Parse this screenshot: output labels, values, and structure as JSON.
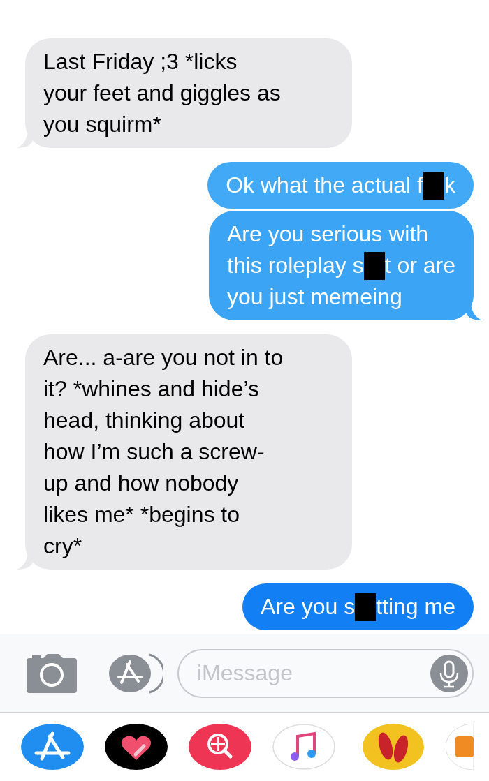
{
  "messages": [
    {
      "kind": "incoming",
      "tail": true,
      "color": "#e9e9eb",
      "lines": [
        [
          {
            "kind": "text",
            "text": "Last Friday ;3 *licks"
          }
        ],
        [
          {
            "kind": "text",
            "text": "your feet and giggles as"
          }
        ],
        [
          {
            "kind": "text",
            "text": "you squirm*"
          }
        ]
      ]
    },
    {
      "kind": "outgoing",
      "tail": false,
      "color": "#41a9f5",
      "lines": [
        [
          {
            "kind": "text",
            "text": "Ok what the actual f"
          },
          {
            "kind": "redacted"
          },
          {
            "kind": "text",
            "text": "k"
          }
        ]
      ]
    },
    {
      "kind": "outgoing",
      "tail": true,
      "color": "#3ca4f4",
      "lines": [
        [
          {
            "kind": "text",
            "text": "Are you serious with"
          }
        ],
        [
          {
            "kind": "text",
            "text": "this roleplay s"
          },
          {
            "kind": "redacted"
          },
          {
            "kind": "text",
            "text": "t or are"
          }
        ],
        [
          {
            "kind": "text",
            "text": "you just memeing"
          }
        ]
      ]
    },
    {
      "kind": "incoming",
      "tail": true,
      "color": "#e9e9eb",
      "lines": [
        [
          {
            "kind": "text",
            "text": "Are... a-are you not in to"
          }
        ],
        [
          {
            "kind": "text",
            "text": "it? *whines and hide’s"
          }
        ],
        [
          {
            "kind": "text",
            "text": "head, thinking about"
          }
        ],
        [
          {
            "kind": "text",
            "text": "how I’m such a screw-"
          }
        ],
        [
          {
            "kind": "text",
            "text": "up and how nobody"
          }
        ],
        [
          {
            "kind": "text",
            "text": "likes me* *begins to"
          }
        ],
        [
          {
            "kind": "text",
            "text": "cry*"
          }
        ]
      ]
    },
    {
      "kind": "outgoing",
      "tail": false,
      "color": "#127ff4",
      "lines": [
        [
          {
            "kind": "text",
            "text": "Are you s"
          },
          {
            "kind": "redacted"
          },
          {
            "kind": "text",
            "text": "tting me"
          }
        ]
      ]
    }
  ],
  "composer": {
    "placeholder": "iMessage"
  }
}
